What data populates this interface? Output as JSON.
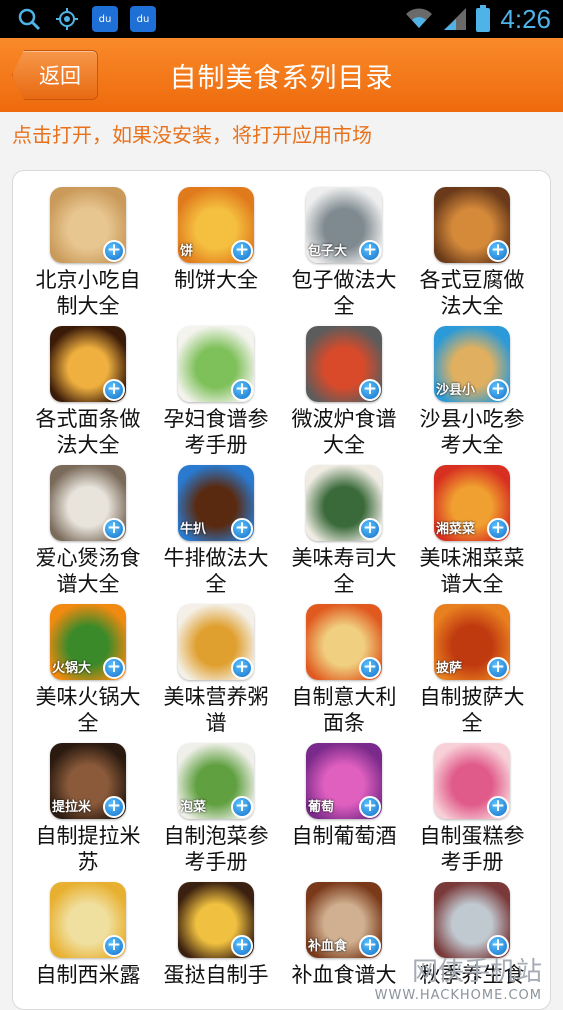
{
  "status_bar": {
    "time": "4:26",
    "icons": [
      "search-icon",
      "gps-icon",
      "baidu-icon",
      "baidu-icon",
      "wifi-icon",
      "signal-icon",
      "battery-icon"
    ]
  },
  "header": {
    "back_label": "返回",
    "title": "自制美食系列目录"
  },
  "hint": "点击打开，如果没安装，将打开应用市场",
  "apps": [
    {
      "label": "北京小吃自制大全",
      "tag": "",
      "c1": "#c99a5a",
      "c2": "#e8c690"
    },
    {
      "label": "制饼大全",
      "tag": "饼",
      "c1": "#e07a1c",
      "c2": "#f5c040"
    },
    {
      "label": "包子做法大全",
      "tag": "包子大",
      "c1": "#eeeeee",
      "c2": "#7f8a90"
    },
    {
      "label": "各式豆腐做法大全",
      "tag": "",
      "c1": "#6a3a1a",
      "c2": "#d58a3a"
    },
    {
      "label": "各式面条做法大全",
      "tag": "",
      "c1": "#3a1a08",
      "c2": "#f0b040"
    },
    {
      "label": "孕妇食谱参考手册",
      "tag": "",
      "c1": "#f4f4ee",
      "c2": "#7ec05a"
    },
    {
      "label": "微波炉食谱大全",
      "tag": "",
      "c1": "#5c5c5c",
      "c2": "#d84a2a"
    },
    {
      "label": "沙县小吃参考大全",
      "tag": "沙县小",
      "c1": "#2a9ad8",
      "c2": "#e0b060"
    },
    {
      "label": "爱心煲汤食谱大全",
      "tag": "",
      "c1": "#7a6a5a",
      "c2": "#e8e4dc"
    },
    {
      "label": "牛排做法大全",
      "tag": "牛扒",
      "c1": "#2a7ad0",
      "c2": "#5a2a10"
    },
    {
      "label": "美味寿司大全",
      "tag": "",
      "c1": "#f0ece4",
      "c2": "#3a6a3a"
    },
    {
      "label": "美味湘菜菜谱大全",
      "tag": "湘菜菜",
      "c1": "#d83020",
      "c2": "#f0a030"
    },
    {
      "label": "美味火锅大全",
      "tag": "火锅大",
      "c1": "#f08a10",
      "c2": "#3a8a2a"
    },
    {
      "label": "美味营养粥谱",
      "tag": "",
      "c1": "#f4f0e8",
      "c2": "#e0a030"
    },
    {
      "label": "自制意大利面条",
      "tag": "",
      "c1": "#e05a20",
      "c2": "#f0d080"
    },
    {
      "label": "自制披萨大全",
      "tag": "披萨",
      "c1": "#e88020",
      "c2": "#c03a10"
    },
    {
      "label": "自制提拉米苏",
      "tag": "提拉米",
      "c1": "#2a1a10",
      "c2": "#8a5a3a"
    },
    {
      "label": "自制泡菜参考手册",
      "tag": "泡菜",
      "c1": "#f0f0ea",
      "c2": "#60a040"
    },
    {
      "label": "自制葡萄酒",
      "tag": "葡萄",
      "c1": "#7a2a8a",
      "c2": "#e060c0"
    },
    {
      "label": "自制蛋糕参考手册",
      "tag": "",
      "c1": "#f8d0d8",
      "c2": "#e05a8a"
    },
    {
      "label": "自制西米露",
      "tag": "",
      "c1": "#e8b030",
      "c2": "#f0e0a0"
    },
    {
      "label": "蛋挞自制手",
      "tag": "",
      "c1": "#3a2010",
      "c2": "#f0c040"
    },
    {
      "label": "补血食谱大",
      "tag": "补血食",
      "c1": "#7a3a1a",
      "c2": "#d0b090"
    },
    {
      "label": "秋季养生食",
      "tag": "",
      "c1": "#7a3a3a",
      "c2": "#c0c8d0"
    }
  ],
  "watermark": {
    "top": "网侠手机站",
    "bottom": "WWW.HACKHOME.COM"
  }
}
